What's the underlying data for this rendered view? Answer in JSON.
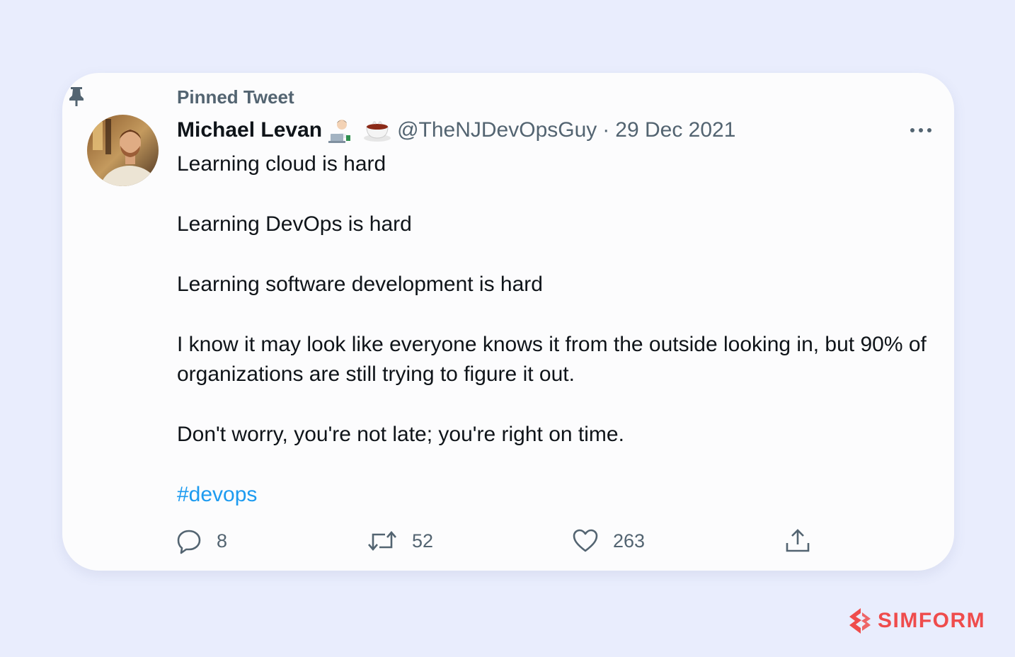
{
  "tweet": {
    "pinned_label": "Pinned Tweet",
    "author": {
      "name": "Michael Levan",
      "handle": "@TheNJDevOpsGuy",
      "separator": "·",
      "date": "29 Dec 2021",
      "emoji_icons": [
        "technologist-icon",
        "coffee-icon"
      ]
    },
    "body": [
      "Learning cloud is hard",
      "Learning DevOps is hard",
      "Learning software development is hard",
      "I know it may look like everyone knows it from the outside looking in, but 90% of organizations are still trying to figure it out.",
      "Don't worry, you're not late; you're right on time."
    ],
    "hashtag": "#devops",
    "actions": {
      "reply_count": "8",
      "retweet_count": "52",
      "like_count": "263"
    }
  },
  "brand": {
    "name": "SIMFORM"
  },
  "colors": {
    "background": "#e9edfd",
    "card": "#fcfcfd",
    "text": "#0f1419",
    "muted": "#536471",
    "link": "#1d9bf0",
    "brand": "#ef4c4c"
  }
}
